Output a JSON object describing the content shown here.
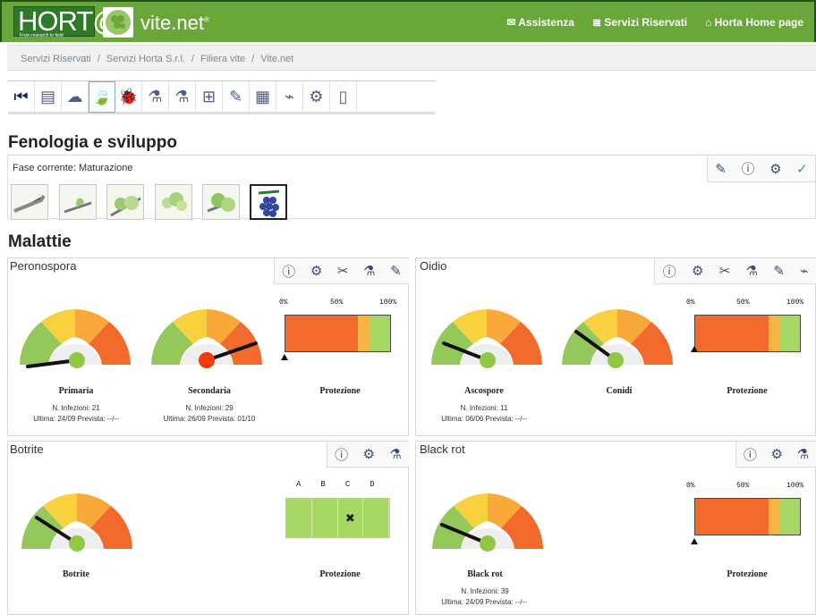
{
  "header": {
    "logo_text": "HORT@",
    "logo_sub": "From research to field",
    "brand": "vite.net",
    "brand_sup": "®",
    "links": [
      "✉ Assistenza",
      "≣ Servizi Riservati",
      "⌂ Horta Home page"
    ]
  },
  "breadcrumb": [
    "Servizi Riservati",
    "/",
    "Servizi Horta S.r.l.",
    "/",
    "Filiera vite",
    "/",
    "Vite.net"
  ],
  "toolbar": [
    "back-icon",
    "document-icon",
    "cloud-icon",
    "leaf-icon",
    "bug-icon",
    "spray-icon",
    "flask-icon",
    "scale-icon",
    "notebook-icon",
    "register-icon",
    "boot-icon",
    "settings-icon",
    "phone-icon"
  ],
  "phenology": {
    "title": "Fenologia e sviluppo",
    "current": "Fase corrente: Maturazione",
    "icons": [
      "pencil-icon",
      "info-icon",
      "gear-icon",
      "check-icon"
    ]
  },
  "diseases": {
    "title": "Malattie"
  },
  "panels": {
    "peronospora": {
      "title": "Peronospora",
      "icons": [
        "info-icon",
        "gear-icon",
        "tools-icon",
        "flask-icon",
        "notebook-icon"
      ],
      "g1": {
        "label": "Primaria",
        "line1": "N. Infezioni: 21",
        "line2": "Ultima: 24/09 Prevista: --/--"
      },
      "g2": {
        "label": "Secondaria",
        "line1": "N. Infezioni: 29",
        "line2": "Ultima: 26/09 Prevista: 01/10"
      },
      "protection": "Protezione",
      "scale": [
        "0%",
        "50%",
        "100%"
      ]
    },
    "oidio": {
      "title": "Oidio",
      "icons": [
        "info-icon",
        "gear-icon",
        "tools-icon",
        "flask-icon",
        "notebook-icon",
        "sample-icon"
      ],
      "g1": {
        "label": "Ascospore",
        "line1": "N. Infezioni: 11",
        "line2": "Ultima: 06/06 Prevista: --/--"
      },
      "g2": {
        "label": "Conidi"
      },
      "protection": "Protezione",
      "scale": [
        "0%",
        "50%",
        "100%"
      ]
    },
    "botrite": {
      "title": "Botrite",
      "icons": [
        "info-icon",
        "gear-icon",
        "flask-icon"
      ],
      "g1": {
        "label": "Botrite"
      },
      "protection": "Protezione",
      "letters": [
        "A",
        "B",
        "C",
        "D"
      ],
      "mark": "✖"
    },
    "blackrot": {
      "title": "Black rot",
      "icons": [
        "info-icon",
        "gear-icon",
        "flask-icon"
      ],
      "g1": {
        "label": "Black rot",
        "line1": "N. Infezioni: 39",
        "line2": "Ultima: 24/09 Prevista: --/--"
      },
      "protection": "Protezione",
      "scale": [
        "0%",
        "50%",
        "100%"
      ]
    }
  },
  "colors": {
    "green": "#6aa73a",
    "bar_red": "#f26a2c",
    "bar_orange": "#f6b543",
    "bar_green": "#a7d865",
    "gauge_red": "#f26a2c"
  }
}
